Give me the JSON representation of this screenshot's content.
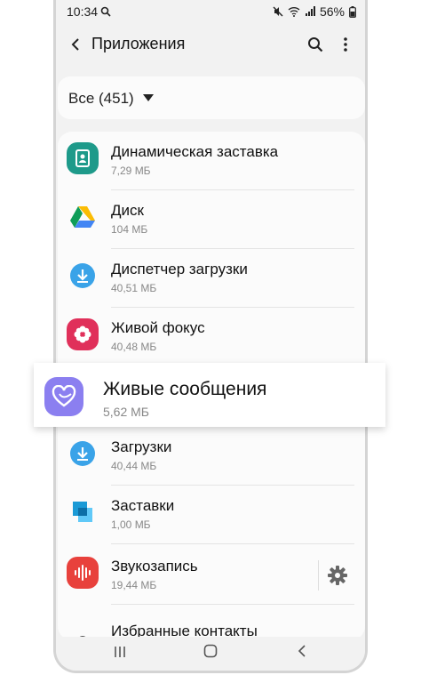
{
  "status_bar": {
    "time": "10:34",
    "battery": "56%"
  },
  "header": {
    "title": "Приложения"
  },
  "filter": {
    "label": "Все (451)"
  },
  "apps": [
    {
      "name": "Динамическая заставка",
      "size": "7,29 МБ",
      "icon": "dynamic-lockscreen-icon"
    },
    {
      "name": "Диск",
      "size": "104 МБ",
      "icon": "google-drive-icon"
    },
    {
      "name": "Диспетчер загрузки",
      "size": "40,51 МБ",
      "icon": "download-manager-icon"
    },
    {
      "name": "Живой фокус",
      "size": "40,48 МБ",
      "icon": "live-focus-icon"
    },
    {
      "name": "Загрузки",
      "size": "40,44 МБ",
      "icon": "downloads-icon"
    },
    {
      "name": "Заставки",
      "size": "1,00 МБ",
      "icon": "screensavers-icon"
    },
    {
      "name": "Звукозапись",
      "size": "19,44 МБ",
      "icon": "voice-recorder-icon"
    },
    {
      "name": "Избранные контакты",
      "size": "",
      "icon": "favorite-contacts-icon"
    }
  ],
  "highlighted_app": {
    "name": "Живые сообщения",
    "size": "5,62 МБ",
    "icon": "live-message-icon"
  },
  "colors": {
    "teal": "#1e9a8a",
    "red": "#e0305a",
    "blue": "#3aa3e8",
    "recorder": "#e8413c",
    "purple": "#8b7ff0"
  }
}
